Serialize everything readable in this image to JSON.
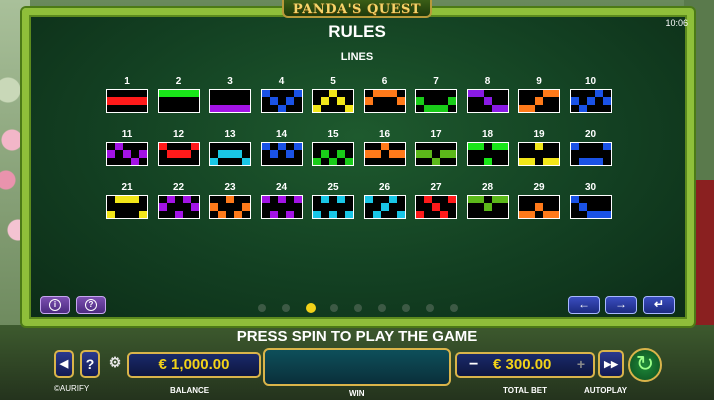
{
  "header": {
    "logo": "PANDA'S QUEST",
    "clock": "10:06",
    "title": "RULES",
    "subtitle": "LINES"
  },
  "colors": {
    "frame": "#8fbf3a",
    "panel_bg": "#134022",
    "accent_yellow": "#f2d219",
    "nav_blue": "#2b3a8e",
    "info_purple": "#7b4fb0"
  },
  "lines": [
    {
      "num": "1",
      "color": "#ff1a1a",
      "rows": [
        1,
        1,
        1,
        1,
        1
      ]
    },
    {
      "num": "2",
      "color": "#19e619",
      "rows": [
        0,
        0,
        0,
        0,
        0
      ]
    },
    {
      "num": "3",
      "color": "#a313e6",
      "rows": [
        2,
        2,
        2,
        2,
        2
      ]
    },
    {
      "num": "4",
      "color": "#1a52e6",
      "rows": [
        0,
        1,
        2,
        1,
        0
      ]
    },
    {
      "num": "5",
      "color": "#f2e619",
      "rows": [
        2,
        1,
        0,
        1,
        2
      ]
    },
    {
      "num": "6",
      "color": "#ff7a1a",
      "rows": [
        1,
        0,
        0,
        0,
        1
      ]
    },
    {
      "num": "7",
      "color": "#19cc19",
      "rows": [
        1,
        2,
        2,
        2,
        1
      ]
    },
    {
      "num": "8",
      "color": "#8a1ae6",
      "rows": [
        0,
        0,
        1,
        2,
        2
      ]
    },
    {
      "num": "9",
      "color": "#ff7a1a",
      "rows": [
        2,
        2,
        1,
        0,
        0
      ]
    },
    {
      "num": "10",
      "color": "#1a52e6",
      "rows": [
        1,
        2,
        1,
        0,
        1
      ]
    },
    {
      "num": "11",
      "color": "#a313e6",
      "rows": [
        1,
        0,
        1,
        2,
        1
      ]
    },
    {
      "num": "12",
      "color": "#ff1a1a",
      "rows": [
        0,
        1,
        1,
        1,
        0
      ]
    },
    {
      "num": "13",
      "color": "#19c6e6",
      "rows": [
        2,
        1,
        1,
        1,
        2
      ]
    },
    {
      "num": "14",
      "color": "#1a52e6",
      "rows": [
        0,
        1,
        0,
        1,
        0
      ]
    },
    {
      "num": "15",
      "color": "#19cc19",
      "rows": [
        2,
        1,
        2,
        1,
        2
      ]
    },
    {
      "num": "16",
      "color": "#ff7a1a",
      "rows": [
        1,
        1,
        0,
        1,
        1
      ]
    },
    {
      "num": "17",
      "color": "#5cb81a",
      "rows": [
        1,
        1,
        2,
        1,
        1
      ]
    },
    {
      "num": "18",
      "color": "#19e619",
      "rows": [
        0,
        0,
        2,
        0,
        0
      ]
    },
    {
      "num": "19",
      "color": "#f2e619",
      "rows": [
        2,
        2,
        0,
        2,
        2
      ]
    },
    {
      "num": "20",
      "color": "#1a52e6",
      "rows": [
        0,
        2,
        2,
        2,
        0
      ]
    },
    {
      "num": "21",
      "color": "#f2e619",
      "rows": [
        2,
        0,
        0,
        0,
        2
      ]
    },
    {
      "num": "22",
      "color": "#a313e6",
      "rows": [
        1,
        0,
        2,
        0,
        1
      ]
    },
    {
      "num": "23",
      "color": "#ff7a1a",
      "rows": [
        1,
        2,
        0,
        2,
        1
      ]
    },
    {
      "num": "24",
      "color": "#a313e6",
      "rows": [
        0,
        2,
        0,
        2,
        0
      ]
    },
    {
      "num": "25",
      "color": "#19c6e6",
      "rows": [
        2,
        0,
        2,
        0,
        2
      ]
    },
    {
      "num": "26",
      "color": "#19c6e6",
      "rows": [
        0,
        2,
        1,
        0,
        2
      ]
    },
    {
      "num": "27",
      "color": "#ff1a1a",
      "rows": [
        2,
        0,
        1,
        2,
        0
      ]
    },
    {
      "num": "28",
      "color": "#5cb81a",
      "rows": [
        0,
        0,
        1,
        0,
        0
      ]
    },
    {
      "num": "29",
      "color": "#ff7a1a",
      "rows": [
        2,
        2,
        1,
        2,
        2
      ]
    },
    {
      "num": "30",
      "color": "#1a52e6",
      "rows": [
        0,
        1,
        2,
        2,
        2
      ]
    }
  ],
  "pagination": {
    "count": 9,
    "active_index": 2
  },
  "controls": {
    "prev_label": "←",
    "next_label": "→",
    "back_label": "↵",
    "info_label": "i",
    "help_label": "?"
  },
  "bottom": {
    "message": "PRESS SPIN TO PLAY THE GAME",
    "balance_value": "€ 1,000.00",
    "balance_label": "BALANCE",
    "win_label": "WIN",
    "bet_minus": "−",
    "bet_value": "€ 300.00",
    "bet_plus": "+",
    "bet_label": "TOTAL BET",
    "autoplay_label": "AUTOPLAY",
    "brand": "©AURIFY",
    "sound_label": "◀",
    "question_label": "?",
    "settings_label": "⚙",
    "autoplay_icon": "▶▶",
    "spin_icon": "↻"
  }
}
